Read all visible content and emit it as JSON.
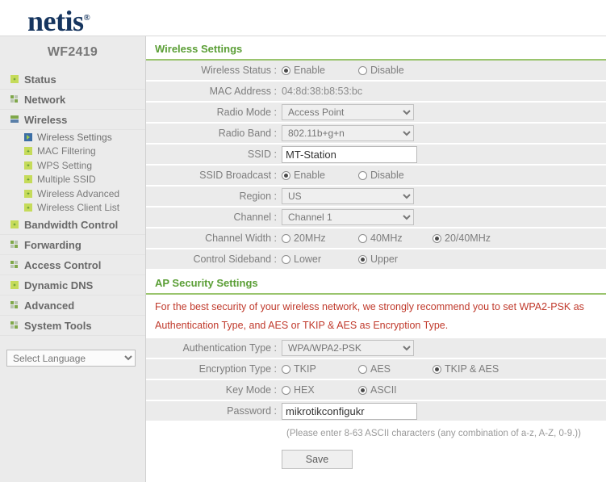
{
  "header": {
    "logo_text": "netis",
    "logo_tm": "®"
  },
  "sidebar": {
    "model": "WF2419",
    "items": [
      {
        "label": "Status",
        "icon": "green-dot-icon"
      },
      {
        "label": "Network",
        "icon": "grid-squares-icon"
      },
      {
        "label": "Wireless",
        "icon": "bars-icon"
      }
    ],
    "wireless_subitems": [
      {
        "label": "Wireless Settings",
        "icon": "blue-arrow-icon",
        "active": true
      },
      {
        "label": "MAC Filtering",
        "icon": "green-dot-icon",
        "active": false
      },
      {
        "label": "WPS Setting",
        "icon": "green-dot-icon",
        "active": false
      },
      {
        "label": "Multiple SSID",
        "icon": "green-dot-icon",
        "active": false
      },
      {
        "label": "Wireless Advanced",
        "icon": "green-dot-icon",
        "active": false
      },
      {
        "label": "Wireless Client List",
        "icon": "green-dot-icon",
        "active": false
      }
    ],
    "items_after": [
      {
        "label": "Bandwidth Control",
        "icon": "green-dot-icon"
      },
      {
        "label": "Forwarding",
        "icon": "grid-squares-icon"
      },
      {
        "label": "Access Control",
        "icon": "grid-squares-icon"
      },
      {
        "label": "Dynamic DNS",
        "icon": "green-dot-icon"
      },
      {
        "label": "Advanced",
        "icon": "grid-squares-icon"
      },
      {
        "label": "System Tools",
        "icon": "grid-squares-icon"
      }
    ],
    "language": {
      "selected": "Select Language",
      "options": [
        "Select Language"
      ]
    }
  },
  "wireless_settings": {
    "title": "Wireless Settings",
    "wireless_status": {
      "label": "Wireless Status :",
      "options": [
        "Enable",
        "Disable"
      ],
      "selected": "Enable"
    },
    "mac_address": {
      "label": "MAC Address :",
      "value": "04:8d:38:b8:53:bc"
    },
    "radio_mode": {
      "label": "Radio Mode :",
      "selected": "Access Point",
      "options": [
        "Access Point"
      ]
    },
    "radio_band": {
      "label": "Radio Band :",
      "selected": "802.11b+g+n",
      "options": [
        "802.11b+g+n"
      ]
    },
    "ssid": {
      "label": "SSID :",
      "value": "MT-Station"
    },
    "ssid_broadcast": {
      "label": "SSID Broadcast :",
      "options": [
        "Enable",
        "Disable"
      ],
      "selected": "Enable"
    },
    "region": {
      "label": "Region :",
      "selected": "US",
      "options": [
        "US"
      ]
    },
    "channel": {
      "label": "Channel :",
      "selected": "Channel 1",
      "options": [
        "Channel 1"
      ]
    },
    "channel_width": {
      "label": "Channel Width :",
      "options": [
        "20MHz",
        "40MHz",
        "20/40MHz"
      ],
      "selected": "20/40MHz"
    },
    "control_sideband": {
      "label": "Control Sideband :",
      "options": [
        "Lower",
        "Upper"
      ],
      "selected": "Upper"
    }
  },
  "ap_security": {
    "title": "AP Security Settings",
    "warning": "For the best security of your wireless network, we strongly recommend you to set WPA2-PSK as Authentication Type, and AES or TKIP & AES as Encryption Type.",
    "authentication_type": {
      "label": "Authentication Type :",
      "selected": "WPA/WPA2-PSK",
      "options": [
        "WPA/WPA2-PSK"
      ]
    },
    "encryption_type": {
      "label": "Encryption Type :",
      "options": [
        "TKIP",
        "AES",
        "TKIP & AES"
      ],
      "selected": "TKIP & AES"
    },
    "key_mode": {
      "label": "Key Mode :",
      "options": [
        "HEX",
        "ASCII"
      ],
      "selected": "ASCII"
    },
    "password": {
      "label": "Password :",
      "value": "mikrotikconfigukr"
    },
    "password_hint": "(Please enter 8-63 ASCII characters (any combination of a-z, A-Z, 0-9.))",
    "save_label": "Save"
  },
  "colors": {
    "brand_navy": "#16355f",
    "section_green": "#5a9e35",
    "warning_red": "#c0392b",
    "sidebar_bg": "#ebebeb"
  }
}
